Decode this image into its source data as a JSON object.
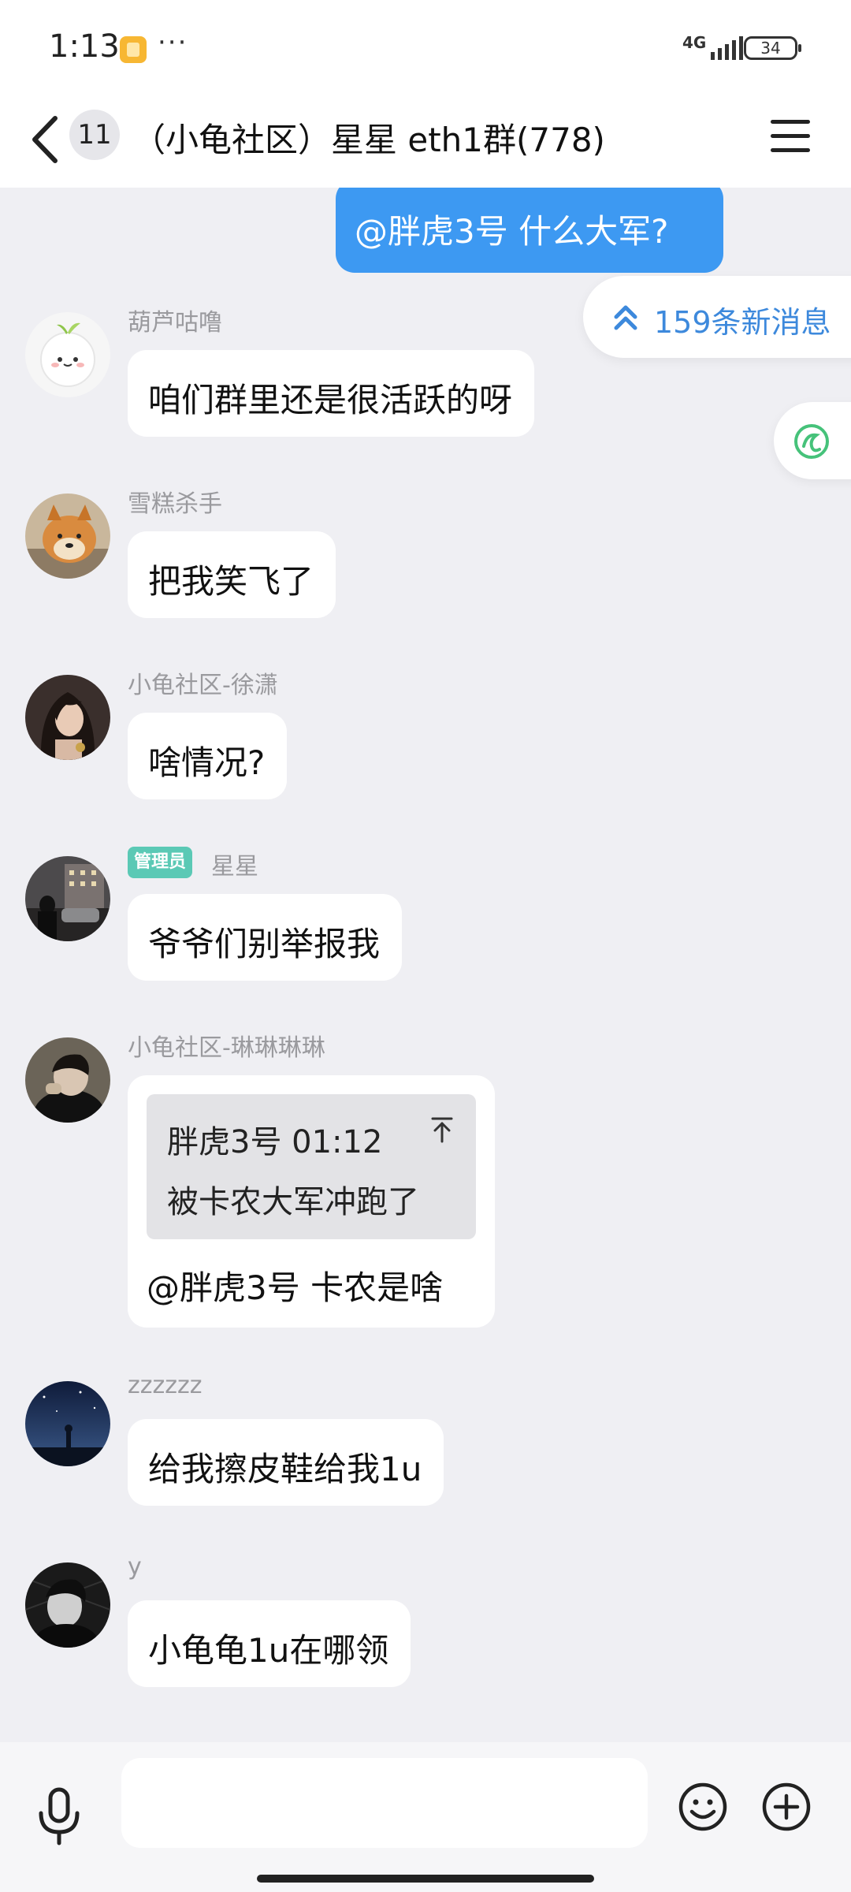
{
  "status_bar": {
    "time": "1:13",
    "more": "···",
    "network": "4G",
    "battery": "34"
  },
  "header": {
    "unread_count": "11",
    "title": "（小龟社区）星星 eth1群(778)"
  },
  "my_message": {
    "text": "@胖虎3号 什么大军?"
  },
  "new_messages_pill": {
    "text": "159条新消息"
  },
  "messages": [
    {
      "sender": "葫芦咕噜",
      "text": "咱们群里还是很活跃的呀"
    },
    {
      "sender": "雪糕杀手",
      "text": "把我笑飞了"
    },
    {
      "sender": "小龟社区-徐潇",
      "text": "啥情况?"
    },
    {
      "badge": "管理员",
      "sender": "星星",
      "text": "爷爷们别举报我"
    },
    {
      "sender": "小龟社区-琳琳琳琳",
      "quote_author_time": "胖虎3号 01:12",
      "quote_text": "被卡农大军冲跑了",
      "text": "@胖虎3号 卡农是啥"
    },
    {
      "sender": "zzzzzz",
      "text": "给我擦皮鞋给我1u"
    },
    {
      "sender": "y",
      "text": "小龟龟1u在哪领"
    }
  ],
  "input": {
    "value": "",
    "placeholder": ""
  },
  "colors": {
    "accent": "#3d99f2",
    "admin_badge": "#5bc9b5",
    "background": "#efeff3"
  }
}
